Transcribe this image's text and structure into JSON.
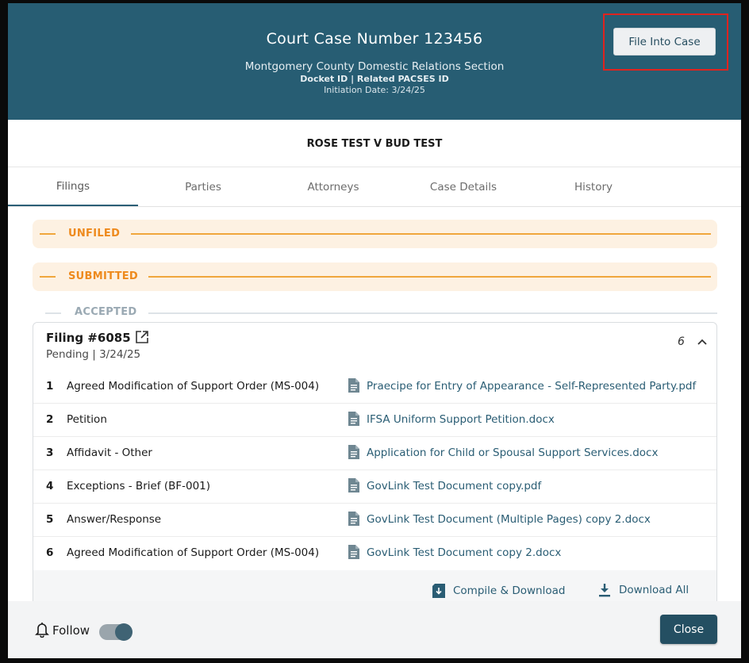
{
  "header": {
    "title": "Court Case Number 123456",
    "court": "Montgomery County Domestic Relations Section",
    "docket": "Docket ID | Related PACSES ID",
    "initiation": "Initiation Date: 3/24/25",
    "file_into_case_label": "File Into Case"
  },
  "case_name": "ROSE TEST V BUD TEST",
  "tabs": [
    {
      "label": "Filings",
      "active": true
    },
    {
      "label": "Parties"
    },
    {
      "label": "Attorneys"
    },
    {
      "label": "Case Details"
    },
    {
      "label": "History"
    }
  ],
  "sections": {
    "unfiled": "UNFILED",
    "submitted": "SUBMITTED",
    "accepted": "ACCEPTED"
  },
  "filing": {
    "title": "Filing #6085",
    "status": "Pending | 3/24/25",
    "count": "6",
    "rows": [
      {
        "num": "1",
        "type": "Agreed Modification of Support Order (MS-004)",
        "document": "Praecipe for Entry of Appearance - Self-Represented Party.pdf"
      },
      {
        "num": "2",
        "type": "Petition",
        "document": "IFSA Uniform Support Petition.docx"
      },
      {
        "num": "3",
        "type": "Affidavit - Other",
        "document": "Application for Child or Spousal Support Services.docx"
      },
      {
        "num": "4",
        "type": "Exceptions - Brief (BF-001)",
        "document": "GovLink Test Document copy.pdf"
      },
      {
        "num": "5",
        "type": "Answer/Response",
        "document": "GovLink Test Document (Multiple Pages) copy 2.docx"
      },
      {
        "num": "6",
        "type": "Agreed Modification of Support Order (MS-004)",
        "document": "GovLink Test Document copy 2.docx"
      }
    ],
    "compile_label": "Compile & Download",
    "download_all_label": "Download All"
  },
  "footer": {
    "follow_label": "Follow",
    "follow_on": true,
    "close_label": "Close"
  },
  "colors": {
    "header_bg": "#275d73",
    "accent": "#ee8a1d",
    "link": "#2a5d74",
    "highlight_box": "#e0231f"
  }
}
